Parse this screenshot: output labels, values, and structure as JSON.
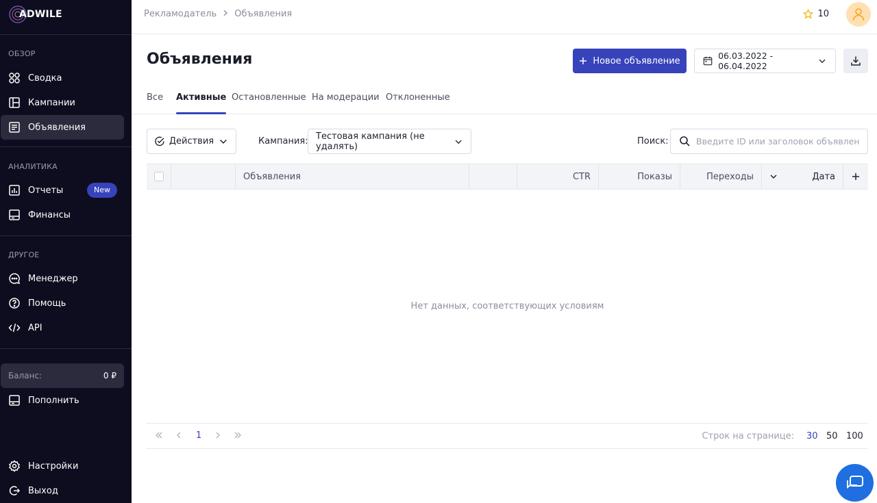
{
  "brand": {
    "name": "ADWILE"
  },
  "sidebar": {
    "sections": [
      {
        "title": "Обзор"
      },
      {
        "title": "Аналитика"
      },
      {
        "title": "Другое"
      }
    ],
    "items": [
      {
        "label": "Сводка",
        "icon": "dashboard-icon"
      },
      {
        "label": "Кампании",
        "icon": "campaigns-icon"
      },
      {
        "label": "Объявления",
        "icon": "ads-icon",
        "active": true
      },
      {
        "label": "Отчеты",
        "icon": "reports-icon",
        "badge": "New"
      },
      {
        "label": "Финансы",
        "icon": "finance-icon"
      },
      {
        "label": "Менеджер",
        "icon": "chat-bubble-icon"
      },
      {
        "label": "Помощь",
        "icon": "help-icon"
      },
      {
        "label": "API",
        "icon": "code-icon"
      },
      {
        "label": "Пополнить",
        "icon": "wallet-icon"
      },
      {
        "label": "Настройки",
        "icon": "gear-icon"
      },
      {
        "label": "Выход",
        "icon": "logout-icon"
      }
    ],
    "balance": {
      "label": "Баланс:",
      "value": "0 ₽"
    }
  },
  "topbar": {
    "breadcrumb": [
      "Рекламодатель",
      "Объявления"
    ],
    "points": "10"
  },
  "header": {
    "title": "Объявления",
    "new_button": "Новое объявление",
    "date_range": "06.03.2022 - 06.04.2022"
  },
  "tabs": [
    {
      "label": "Все"
    },
    {
      "label": "Активные",
      "active": true
    },
    {
      "label": "Остановленные"
    },
    {
      "label": "На модерации"
    },
    {
      "label": "Отклоненные"
    }
  ],
  "filters": {
    "actions_label": "Действия",
    "campaign_label": "Кампания:",
    "campaign_value": "Тестовая кампания (не удалять)",
    "search_label": "Поиск:",
    "search_placeholder": "Введите ID или заголовок объявления",
    "search_value": ""
  },
  "table": {
    "columns": [
      "Объявления",
      "CTR",
      "Показы",
      "Переходы",
      "Дата"
    ],
    "empty_message": "Нет данных, соответствующих условиям"
  },
  "pagination": {
    "current_page": "1",
    "rows_label": "Строк на странице:",
    "rows_options": [
      "30",
      "50",
      "100"
    ],
    "rows_selected": "30"
  },
  "colors": {
    "accent": "#3643ba",
    "sidebar_bg": "#0d0d1f",
    "chat": "#1f6fe0"
  }
}
